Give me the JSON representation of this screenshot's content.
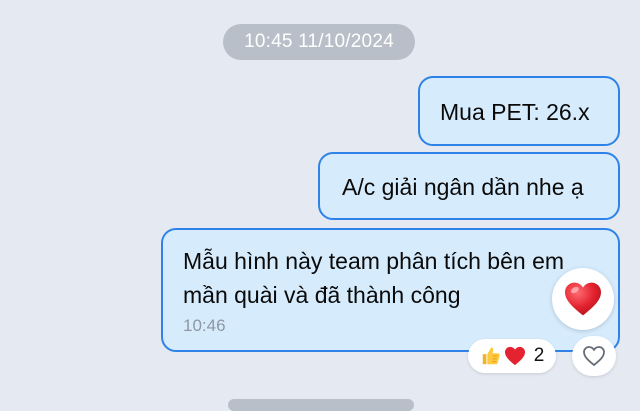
{
  "timestamp_chip": "10:45 11/10/2024",
  "messages": [
    {
      "text": "Mua PET: 26.x"
    },
    {
      "text": "A/c giải ngân dần nhe ạ"
    },
    {
      "lines": [
        "Mẫu hình này team phân tích bên em",
        "mần quài và đã thành công"
      ],
      "time": "10:46"
    }
  ],
  "reactions": {
    "big_emoji": "heart",
    "summary_icons": [
      "thumbs-up",
      "heart"
    ],
    "count": "2"
  },
  "colors": {
    "background": "#e4e9f2",
    "bubble_fill": "#d6ecfd",
    "bubble_border": "#2f83e8",
    "chip": "#b9bfc9",
    "heart": "#e3232f"
  }
}
